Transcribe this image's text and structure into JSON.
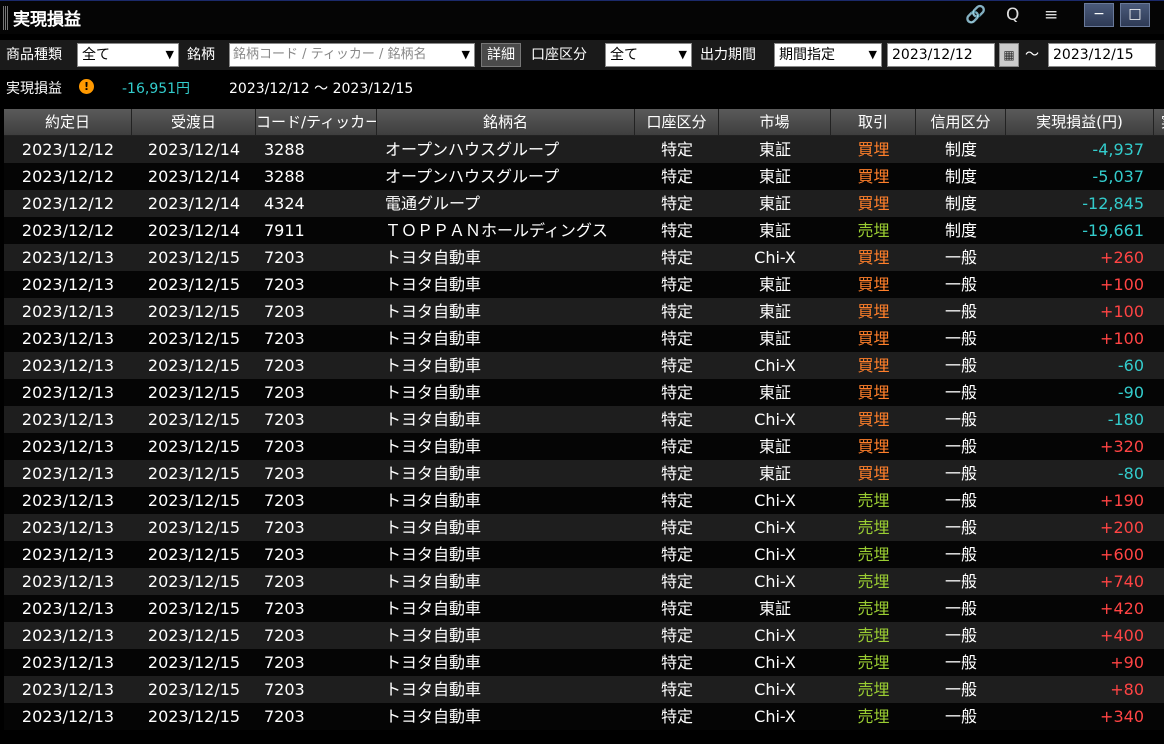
{
  "window": {
    "title": "実現損益",
    "link_icon": "🔗",
    "search_icon": "Q",
    "menu_icon": "≡",
    "minimize_label": "−",
    "maximize_label": "□"
  },
  "filters": {
    "product_type_label": "商品種類",
    "product_type_value": "全て",
    "stock_label": "銘柄",
    "stock_placeholder": "銘柄コード / ティッカー / 銘柄名",
    "detail_button": "詳細",
    "account_label": "口座区分",
    "account_value": "全て",
    "period_label": "出力期間",
    "period_value": "期間指定",
    "date_from": "2023/12/12",
    "tilde": "～",
    "date_to": "2023/12/15"
  },
  "summary": {
    "label": "実現損益",
    "warn_symbol": "!",
    "total": "-16,951円",
    "range": "2023/12/12 ～ 2023/12/15"
  },
  "table": {
    "headers": [
      "約定日",
      "受渡日",
      "コード/ティッカー",
      "銘柄名",
      "口座区分",
      "市場",
      "取引",
      "信用区分",
      "実現損益(円)",
      "実"
    ],
    "rows": [
      [
        "2023/12/12",
        "2023/12/14",
        "3288",
        "オープンハウスグループ",
        "特定",
        "東証",
        "買埋",
        "制度",
        "-4,937"
      ],
      [
        "2023/12/12",
        "2023/12/14",
        "3288",
        "オープンハウスグループ",
        "特定",
        "東証",
        "買埋",
        "制度",
        "-5,037"
      ],
      [
        "2023/12/12",
        "2023/12/14",
        "4324",
        "電通グループ",
        "特定",
        "東証",
        "買埋",
        "制度",
        "-12,845"
      ],
      [
        "2023/12/12",
        "2023/12/14",
        "7911",
        "ＴＯＰＰＡＮホールディングス",
        "特定",
        "東証",
        "売埋",
        "制度",
        "-19,661"
      ],
      [
        "2023/12/13",
        "2023/12/15",
        "7203",
        "トヨタ自動車",
        "特定",
        "Chi-X",
        "買埋",
        "一般",
        "+260"
      ],
      [
        "2023/12/13",
        "2023/12/15",
        "7203",
        "トヨタ自動車",
        "特定",
        "東証",
        "買埋",
        "一般",
        "+100"
      ],
      [
        "2023/12/13",
        "2023/12/15",
        "7203",
        "トヨタ自動車",
        "特定",
        "東証",
        "買埋",
        "一般",
        "+100"
      ],
      [
        "2023/12/13",
        "2023/12/15",
        "7203",
        "トヨタ自動車",
        "特定",
        "東証",
        "買埋",
        "一般",
        "+100"
      ],
      [
        "2023/12/13",
        "2023/12/15",
        "7203",
        "トヨタ自動車",
        "特定",
        "Chi-X",
        "買埋",
        "一般",
        "-60"
      ],
      [
        "2023/12/13",
        "2023/12/15",
        "7203",
        "トヨタ自動車",
        "特定",
        "東証",
        "買埋",
        "一般",
        "-90"
      ],
      [
        "2023/12/13",
        "2023/12/15",
        "7203",
        "トヨタ自動車",
        "特定",
        "Chi-X",
        "買埋",
        "一般",
        "-180"
      ],
      [
        "2023/12/13",
        "2023/12/15",
        "7203",
        "トヨタ自動車",
        "特定",
        "東証",
        "買埋",
        "一般",
        "+320"
      ],
      [
        "2023/12/13",
        "2023/12/15",
        "7203",
        "トヨタ自動車",
        "特定",
        "東証",
        "買埋",
        "一般",
        "-80"
      ],
      [
        "2023/12/13",
        "2023/12/15",
        "7203",
        "トヨタ自動車",
        "特定",
        "Chi-X",
        "売埋",
        "一般",
        "+190"
      ],
      [
        "2023/12/13",
        "2023/12/15",
        "7203",
        "トヨタ自動車",
        "特定",
        "Chi-X",
        "売埋",
        "一般",
        "+200"
      ],
      [
        "2023/12/13",
        "2023/12/15",
        "7203",
        "トヨタ自動車",
        "特定",
        "Chi-X",
        "売埋",
        "一般",
        "+600"
      ],
      [
        "2023/12/13",
        "2023/12/15",
        "7203",
        "トヨタ自動車",
        "特定",
        "Chi-X",
        "売埋",
        "一般",
        "+740"
      ],
      [
        "2023/12/13",
        "2023/12/15",
        "7203",
        "トヨタ自動車",
        "特定",
        "東証",
        "売埋",
        "一般",
        "+420"
      ],
      [
        "2023/12/13",
        "2023/12/15",
        "7203",
        "トヨタ自動車",
        "特定",
        "Chi-X",
        "売埋",
        "一般",
        "+400"
      ],
      [
        "2023/12/13",
        "2023/12/15",
        "7203",
        "トヨタ自動車",
        "特定",
        "Chi-X",
        "売埋",
        "一般",
        "+90"
      ],
      [
        "2023/12/13",
        "2023/12/15",
        "7203",
        "トヨタ自動車",
        "特定",
        "Chi-X",
        "売埋",
        "一般",
        "+80"
      ],
      [
        "2023/12/13",
        "2023/12/15",
        "7203",
        "トヨタ自動車",
        "特定",
        "Chi-X",
        "売埋",
        "一般",
        "+340"
      ]
    ]
  },
  "colors": {
    "buy": "#ff7f2a",
    "sell": "#9acd32",
    "loss": "#33cccc",
    "profit": "#ff4444",
    "warning": "#ff9900"
  }
}
